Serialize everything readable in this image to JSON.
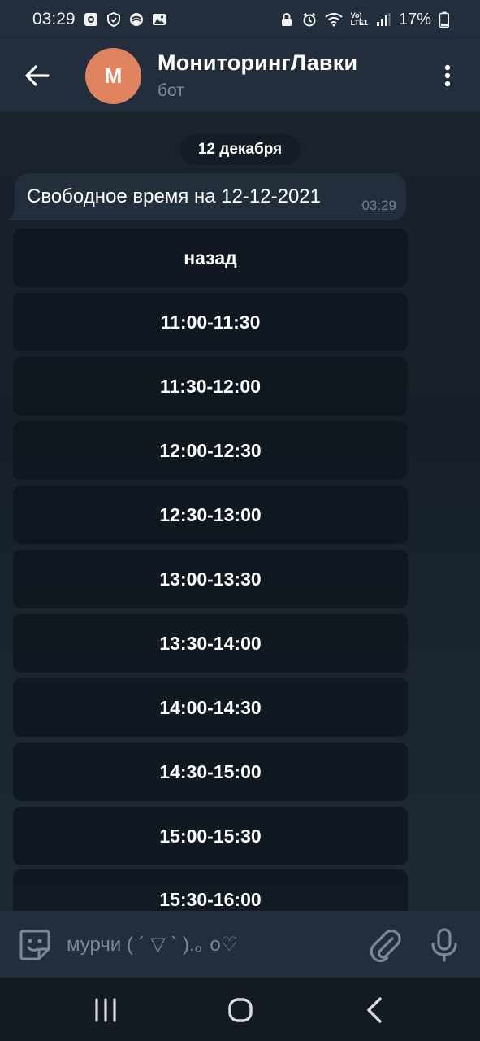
{
  "status_bar": {
    "time": "03:29",
    "left_icons": [
      "notification-square-icon",
      "shield-icon",
      "app-icon",
      "image-icon"
    ],
    "right_icons": [
      "lock-icon",
      "alarm-icon",
      "wifi-icon",
      "lte-signal-icon"
    ],
    "network_label_top": "Vo)",
    "network_label_bottom": "LTE1",
    "battery_percent": "17%"
  },
  "header": {
    "avatar_letter": "M",
    "avatar_color": "#e0835f",
    "title": "МониторингЛавки",
    "subtitle": "бот"
  },
  "chat": {
    "date_label": "12 декабря",
    "message": {
      "text": "Свободное время на 12-12-2021",
      "time": "03:29"
    },
    "keyboard_buttons": [
      "назад",
      "11:00-11:30",
      "11:30-12:00",
      "12:00-12:30",
      "12:30-13:00",
      "13:00-13:30",
      "13:30-14:00",
      "14:00-14:30",
      "14:30-15:00",
      "15:00-15:30",
      "15:30-16:00"
    ]
  },
  "input_bar": {
    "placeholder": "мурчи ( ´ ▽ ` ).｡ o♡"
  },
  "colors": {
    "header_bg": "#232e3c",
    "chat_bg": "#1a222c",
    "accent": "#e0835f"
  }
}
